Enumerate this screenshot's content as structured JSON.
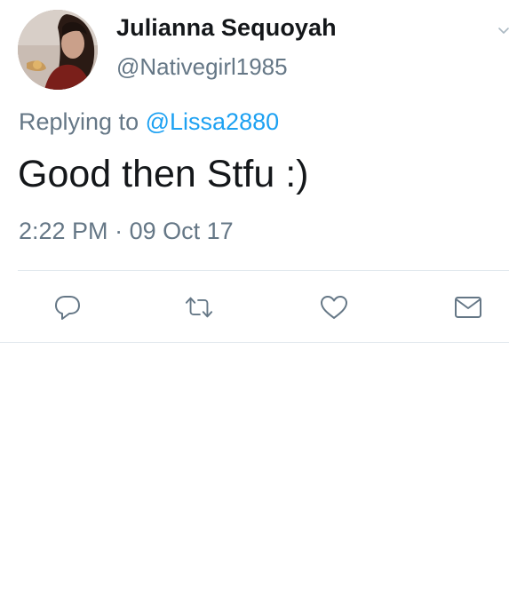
{
  "author": {
    "display_name": "Julianna Sequoyah",
    "handle": "@Nativegirl1985"
  },
  "reply_context": {
    "prefix": "Replying to",
    "mention": "@Lissa2880"
  },
  "tweet": {
    "text": "Good then Stfu :)",
    "time": "2:22 PM",
    "separator": "·",
    "date": "09 Oct 17"
  },
  "actions": {
    "reply_icon": "reply-icon",
    "retweet_icon": "retweet-icon",
    "like_icon": "heart-icon",
    "dm_icon": "envelope-icon"
  },
  "colors": {
    "text": "#14171a",
    "secondary": "#657786",
    "link": "#1da1f2",
    "divider": "#e1e8ed"
  }
}
